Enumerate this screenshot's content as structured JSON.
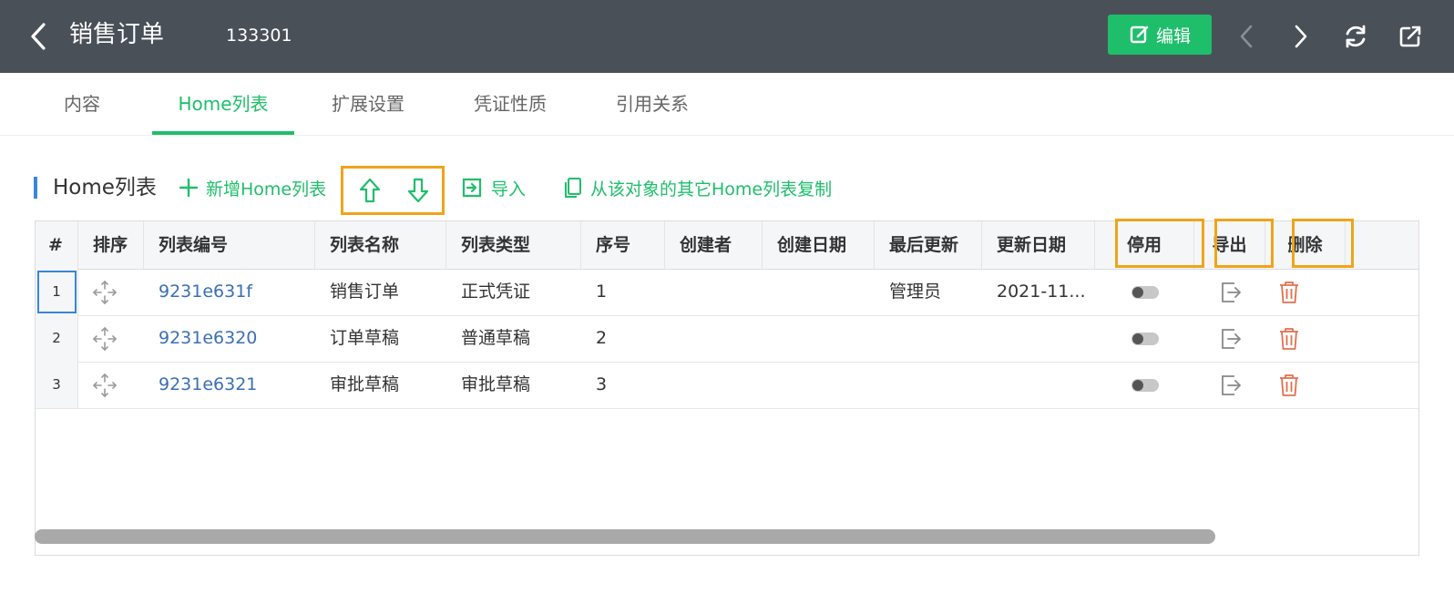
{
  "header": {
    "title": "销售订单",
    "doc_number": "133301",
    "edit_label": "编辑",
    "bg_color": "#4a5058",
    "accent_color": "#1fbe6b"
  },
  "tabs": [
    {
      "label": "内容",
      "active": false
    },
    {
      "label": "Home列表",
      "active": true
    },
    {
      "label": "扩展设置",
      "active": false
    },
    {
      "label": "凭证性质",
      "active": false
    },
    {
      "label": "引用关系",
      "active": false
    }
  ],
  "toolbar": {
    "section_title": "Home列表",
    "add_label": "新增Home列表",
    "import_label": "导入",
    "copy_label": "从该对象的其它Home列表复制"
  },
  "table": {
    "columns": [
      "#",
      "排序",
      "列表编号",
      "列表名称",
      "列表类型",
      "序号",
      "创建者",
      "创建日期",
      "最后更新",
      "更新日期",
      "停用",
      "导出",
      "删除"
    ],
    "rows": [
      {
        "idx": "1",
        "code": "9231e631f",
        "name": "销售订单",
        "type": "正式凭证",
        "seq": "1",
        "creator": "",
        "created": "",
        "updated_by": "管理员",
        "updated": "2021-11...",
        "disabled": false
      },
      {
        "idx": "2",
        "code": "9231e6320",
        "name": "订单草稿",
        "type": "普通草稿",
        "seq": "2",
        "creator": "",
        "created": "",
        "updated_by": "",
        "updated": "",
        "disabled": false
      },
      {
        "idx": "3",
        "code": "9231e6321",
        "name": "审批草稿",
        "type": "审批草稿",
        "seq": "3",
        "creator": "",
        "created": "",
        "updated_by": "",
        "updated": "",
        "disabled": false
      }
    ]
  },
  "icons": {
    "back": "chevron-left-icon",
    "edit": "edit-icon",
    "prev": "chevron-left-icon",
    "next": "chevron-right-icon",
    "refresh": "refresh-icon",
    "open_external": "open-external-icon",
    "add": "plus-icon",
    "up": "arrow-up-icon",
    "down": "arrow-down-icon",
    "import": "import-icon",
    "copy": "copy-icon",
    "drag": "move-icon",
    "toggle": "toggle-icon",
    "export": "export-icon",
    "delete": "trash-icon"
  },
  "highlight_color": "#f0a418",
  "delete_color": "#e0704f"
}
